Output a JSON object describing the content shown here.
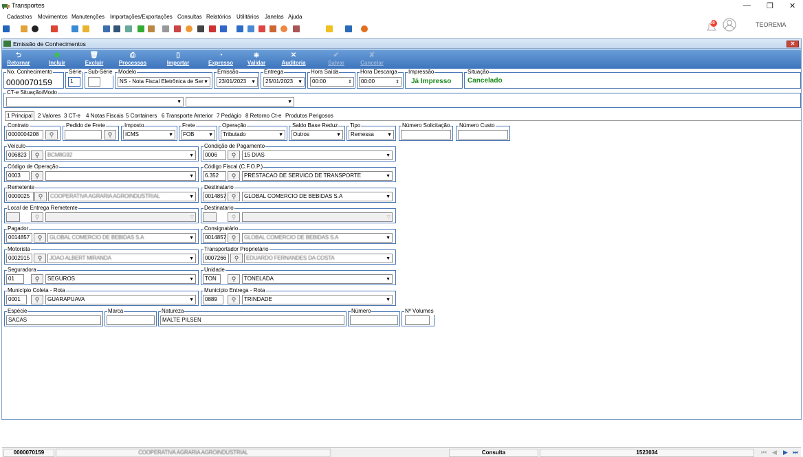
{
  "window": {
    "title": "Transportes"
  },
  "menu": [
    "Cadastros",
    "Movimentos",
    "Manutenções",
    "Importações/Exportações",
    "Consultas",
    "Relatórios",
    "Utilitários",
    "Janelas",
    "Ajuda"
  ],
  "topright": {
    "user": "TEOREMA",
    "badge": "00"
  },
  "child": {
    "title": "Emissão de Conhecimentos"
  },
  "actions": [
    "Retornar",
    "Incluir",
    "Excluir",
    "Processos",
    "Importar",
    "Expresso",
    "Validar",
    "Auditoria",
    "Salvar",
    "Cancelar"
  ],
  "header": {
    "no_conhecimento": {
      "label": "No. Conhecimento",
      "value": "0000070159"
    },
    "serie": {
      "label": "Série",
      "value": "1"
    },
    "subserie": {
      "label": "Sub-Série",
      "value": ""
    },
    "modelo": {
      "label": "Modelo",
      "value": "NS - Nota Fiscal Eletrônica de Ser"
    },
    "emissao": {
      "label": "Emissão",
      "value": "23/01/2023"
    },
    "entrega": {
      "label": "Entrega",
      "value": "25/01/2023"
    },
    "hora_saida": {
      "label": "Hora Saída",
      "value": "00:00"
    },
    "hora_descarga": {
      "label": "Hora Descarga",
      "value": "00:00"
    },
    "impressao": {
      "label": "Impressão",
      "value": "Já Impresso"
    },
    "situacao": {
      "label": "Situação",
      "value": "Cancelado"
    }
  },
  "cte": {
    "label": "CT-e Situação/Modo"
  },
  "tabs": [
    "1 Principal",
    "2 Valores",
    "3 CT-e",
    "4 Notas Fiscais",
    "5 Containers",
    "6 Transporte Anterior",
    "7 Pedágio",
    "8 Retorno Ct-e",
    "Produtos Perigosos"
  ],
  "row1": {
    "contrato": {
      "label": "Contrato",
      "value": "0000004208"
    },
    "pedido": {
      "label": "Pedido de Frete",
      "value": ""
    },
    "imposto": {
      "label": "Imposto",
      "value": "ICMS"
    },
    "frete": {
      "label": "Frete",
      "value": "FOB"
    },
    "operacao": {
      "label": "Operação",
      "value": "Tributado"
    },
    "saldo": {
      "label": "Saldo Base Reduz",
      "value": "Outros"
    },
    "tipo": {
      "label": "Tipo",
      "value": "Remessa"
    },
    "numsol": {
      "label": "Número Solicitação",
      "value": ""
    },
    "numcusto": {
      "label": "Número Custo",
      "value": ""
    }
  },
  "left": [
    {
      "label": "Veículo",
      "code": "006823",
      "desc": "BCM8G92"
    },
    {
      "label": "Código de Operação",
      "code": "0003",
      "desc": ""
    },
    {
      "label": "Remetente",
      "code": "0000025",
      "desc": "COOPERATIVA AGRARIA AGROINDUSTRIAL"
    },
    {
      "label": "Local de Entrega Remetente",
      "code": "",
      "desc": ""
    },
    {
      "label": "Pagador",
      "code": "0014857",
      "desc": "GLOBAL COMERCIO DE BEBIDAS S.A"
    },
    {
      "label": "Motorista",
      "code": "0002915",
      "desc": "JOAO ALBERT MIRANDA"
    },
    {
      "label": "Seguradora",
      "code": "01",
      "desc": "SEGUROS"
    },
    {
      "label": "Município Coleta - Rota",
      "code": "0001",
      "desc": "GUARAPUAVA"
    }
  ],
  "right": [
    {
      "label": "Condição de Pagamento",
      "code": "0006",
      "desc": "15 DIAS"
    },
    {
      "label": "Código Fiscal (C.F.O.P.)",
      "code": "6.352",
      "desc": "PRESTACAO DE SERVICO DE TRANSPORTE"
    },
    {
      "label": "Destinatario",
      "code": "0014857",
      "desc": "GLOBAL COMERCIO DE BEBIDAS S.A"
    },
    {
      "label": "Destinatario",
      "code": "",
      "desc": ""
    },
    {
      "label": "Consignatário",
      "code": "0014857",
      "desc": "GLOBAL COMERCIO DE BEBIDAS S.A"
    },
    {
      "label": "Transportador Proprietário",
      "code": "0007266",
      "desc": "EDUARDO FERNANDES DA COSTA"
    },
    {
      "label": "Unidade",
      "code": "TON",
      "desc": "TONELADA"
    },
    {
      "label": "Município Entrega - Rota",
      "code": "0889",
      "desc": "TRINDADE"
    }
  ],
  "bottom": {
    "especie": {
      "label": "Espécie",
      "value": "SACAS"
    },
    "marca": {
      "label": "Marca",
      "value": ""
    },
    "natureza": {
      "label": "Natureza",
      "value": "MALTE PILSEN"
    },
    "numero": {
      "label": "Número",
      "value": ""
    },
    "volumes": {
      "label": "Nº Volumes",
      "value": ""
    }
  },
  "status": {
    "doc": "0000070159",
    "client": "COOPERATIVA AGRARIA AGROINDUSTRIAL",
    "mode": "Consulta",
    "id": "1523034"
  }
}
